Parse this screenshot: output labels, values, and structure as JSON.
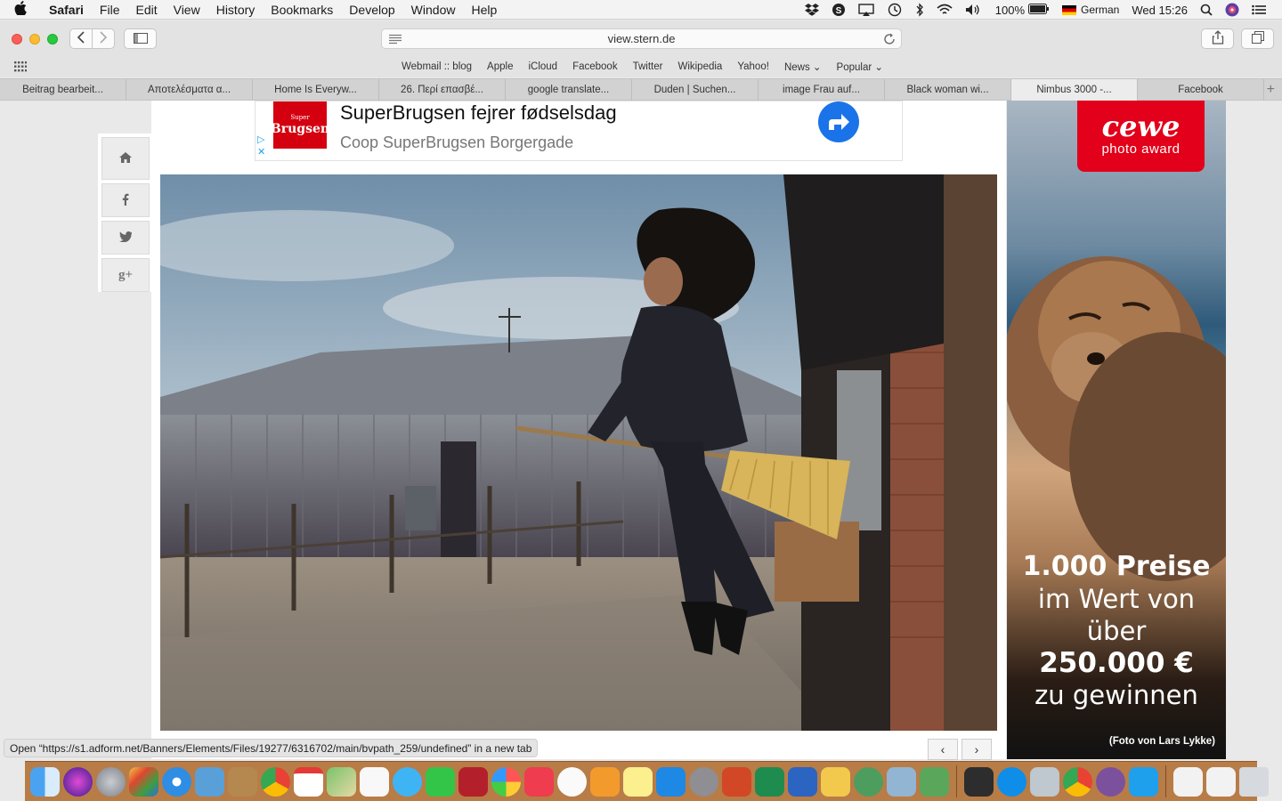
{
  "menubar": {
    "app_name": "Safari",
    "menus": [
      "File",
      "Edit",
      "View",
      "History",
      "Bookmarks",
      "Develop",
      "Window",
      "Help"
    ],
    "battery": "100%",
    "input_source": "German",
    "clock": "Wed 15:26"
  },
  "toolbar": {
    "url": "view.stern.de"
  },
  "favorites": [
    "Webmail :: blog",
    "Apple",
    "iCloud",
    "Facebook",
    "Twitter",
    "Wikipedia",
    "Yahoo!",
    "News ⌄",
    "Popular ⌄"
  ],
  "tabs": [
    {
      "label": "Beitrag bearbeit..."
    },
    {
      "label": "Αποτελέσματα α..."
    },
    {
      "label": "Home Is Everyw..."
    },
    {
      "label": "26. Περί επασβέ..."
    },
    {
      "label": "google translate..."
    },
    {
      "label": "Duden | Suchen..."
    },
    {
      "label": "image Frau auf..."
    },
    {
      "label": "Black woman wi..."
    },
    {
      "label": "Nimbus 3000 -..."
    },
    {
      "label": "Facebook"
    }
  ],
  "active_tab_index": 8,
  "ad_top": {
    "logo_small": "Super",
    "logo_big": "Brugsen",
    "title": "SuperBrugsen fejrer fødselsdag",
    "subtitle": "Coop SuperBrugsen Borgergade",
    "accent_color": "#1a73e8"
  },
  "social": [
    {
      "icon": "home-icon",
      "glyph": "⌂"
    },
    {
      "icon": "facebook-icon",
      "glyph": "f"
    },
    {
      "icon": "twitter-icon",
      "glyph": "t"
    },
    {
      "icon": "google-plus-icon",
      "glyph": "g+"
    }
  ],
  "ad_right": {
    "brand": "cewe",
    "brand_sub": "photo award",
    "line1": "1.000 Preise",
    "line2": "im Wert von",
    "line3": "über",
    "line4": "250.000 €",
    "line5": "zu gewinnen",
    "credit": "(Foto von Lars Lykke)",
    "brand_color": "#e2001a"
  },
  "status_url": "Open “https://s1.adform.net/Banners/Elements/Files/19277/6316702/main/bvpath_259/undefined” in a new tab",
  "pager": {
    "prev": "‹",
    "next": "›"
  },
  "dock_icons": [
    "finder-icon",
    "siri-icon",
    "launchpad-icon",
    "mission-control-icon",
    "safari-icon",
    "mail-icon",
    "notes-icon",
    "chrome-icon",
    "calendar-icon",
    "maps-icon",
    "reminders-icon",
    "messages-icon",
    "facetime-icon",
    "photo-booth-icon",
    "photos-icon",
    "news-icon",
    "music-icon",
    "books-icon",
    "stickies-icon",
    "app-store-icon",
    "system-preferences-icon",
    "powerpoint-icon",
    "excel-icon",
    "word-icon",
    "outlook-icon",
    "network-icon",
    "preview-icon",
    "chess-icon",
    "screenshot-icon",
    "teamviewer-icon",
    "image-capture-icon",
    "chrome-icon",
    "viber-icon",
    "skype-icon",
    "document-icon",
    "document-icon",
    "trash-icon"
  ]
}
